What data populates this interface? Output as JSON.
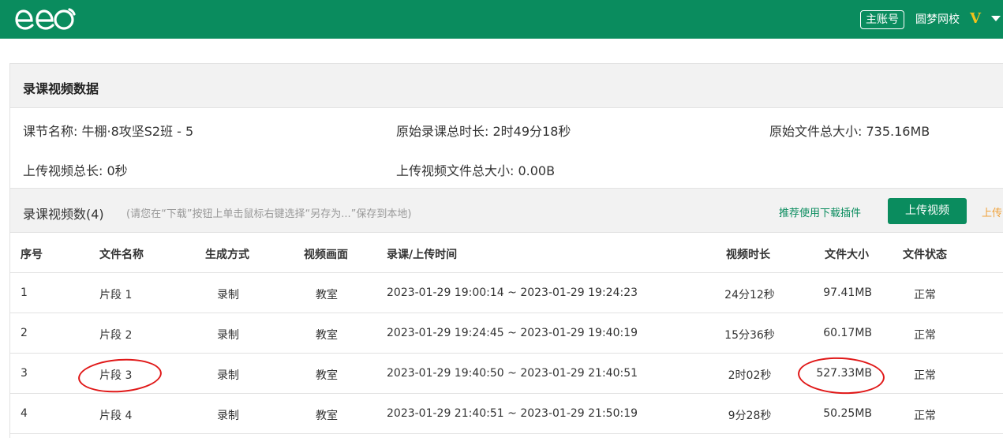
{
  "header": {
    "logo_text": "eeo",
    "account_button": "主账号",
    "school_name": "圆梦网校",
    "vip_badge": "V"
  },
  "panel": {
    "title": "录课视频数据",
    "info": {
      "lesson_name": "课节名称: 牛棚·8攻坚S2班 - 5",
      "original_duration": "原始录课总时长: 2时49分18秒",
      "original_size": "原始文件总大小: 735.16MB",
      "upload_duration": "上传视频总长: 0秒",
      "upload_size": "上传视频文件总大小: 0.00B"
    }
  },
  "video_list": {
    "title": "录课视频数(4)",
    "hint": "(请您在“下载”按钮上单击鼠标右键选择“另存为...”保存到本地)",
    "plugin_link": "推荐使用下载插件",
    "upload_button": "上传视频",
    "upload_link_partial": "上传",
    "columns": [
      "序号",
      "文件名称",
      "生成方式",
      "视频画面",
      "录课/上传时间",
      "视频时长",
      "文件大小",
      "文件状态"
    ],
    "rows": [
      {
        "idx": "1",
        "name": "片段 1",
        "mode": "录制",
        "view": "教室",
        "time": "2023-01-29 19:00:14 ~ 2023-01-29 19:24:23",
        "duration": "24分12秒",
        "size": "97.41MB",
        "status": "正常"
      },
      {
        "idx": "2",
        "name": "片段 2",
        "mode": "录制",
        "view": "教室",
        "time": "2023-01-29 19:24:45 ~ 2023-01-29 19:40:19",
        "duration": "15分36秒",
        "size": "60.17MB",
        "status": "正常"
      },
      {
        "idx": "3",
        "name": "片段 3",
        "mode": "录制",
        "view": "教室",
        "time": "2023-01-29 19:40:50 ~ 2023-01-29 21:40:51",
        "duration": "2时02秒",
        "size": "527.33MB",
        "status": "正常"
      },
      {
        "idx": "4",
        "name": "片段 4",
        "mode": "录制",
        "view": "教室",
        "time": "2023-01-29 21:40:51 ~ 2023-01-29 21:50:19",
        "duration": "9分28秒",
        "size": "50.25MB",
        "status": "正常"
      }
    ]
  },
  "colors": {
    "brand_green": "#0a8c5e",
    "highlight_red": "#e01818",
    "vip_gold": "#f3c21b",
    "link_orange": "#f0a23a"
  }
}
